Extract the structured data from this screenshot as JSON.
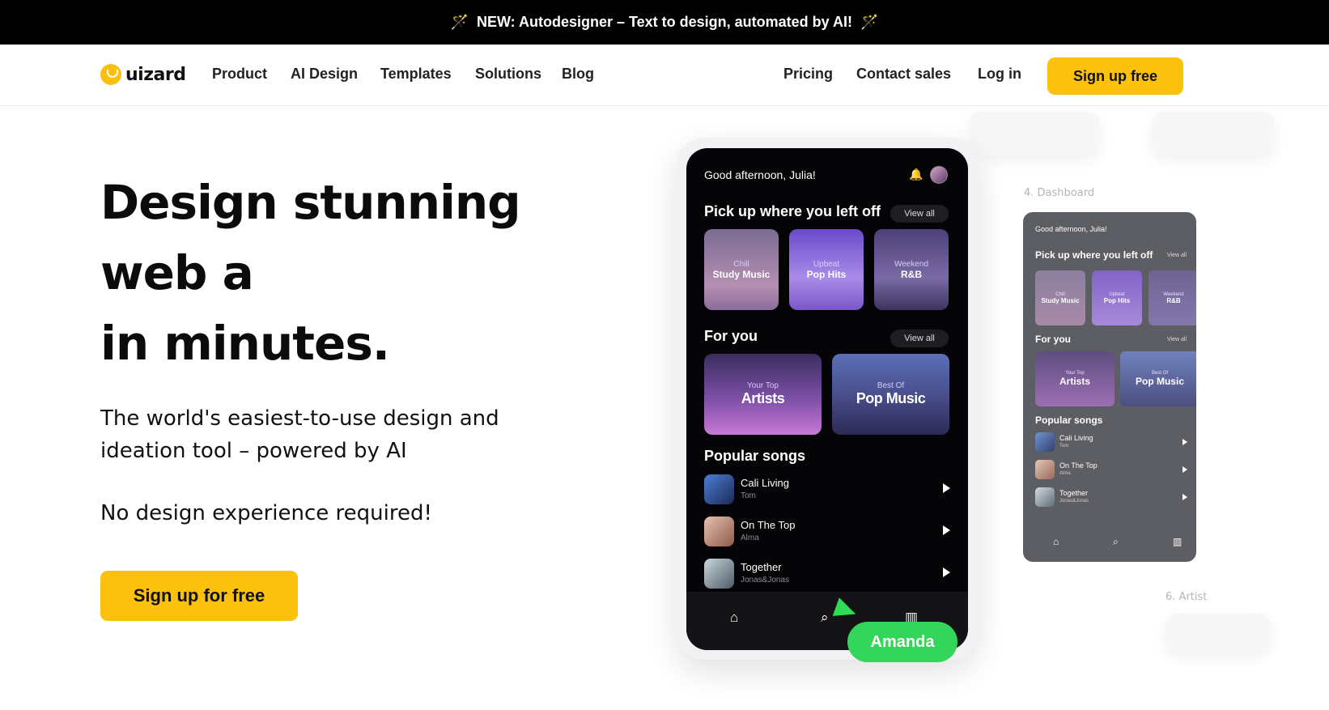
{
  "banner": {
    "text": "NEW: Autodesigner – Text to design, automated by AI!",
    "icon_left": "magic-wand-icon",
    "icon_right": "magic-wand-icon"
  },
  "nav": {
    "logo_text": "uizard",
    "links": [
      "Product",
      "AI Design",
      "Templates",
      "Solutions",
      "Blog"
    ],
    "right_links": [
      "Pricing",
      "Contact sales",
      "Log in"
    ],
    "cta": "Sign up free"
  },
  "hero": {
    "title_lines": [
      "Design stunning",
      "web a",
      "in minutes."
    ],
    "subtitle": "The world's easiest-to-use design and ideation tool – powered by AI",
    "note": "No design experience required!",
    "cta": "Sign up for free"
  },
  "mockup": {
    "greeting": "Good afternoon, Julia!",
    "section_recent": "Pick up where you left off",
    "view_all": "View all",
    "recent_tiles": [
      {
        "small": "Chill",
        "big": "Study Music"
      },
      {
        "small": "Upbeat",
        "big": "Pop Hits"
      },
      {
        "small": "Weekend",
        "big": "R&B"
      }
    ],
    "section_for_you": "For you",
    "for_you_tiles": [
      {
        "small": "Your Top",
        "big": "Artists"
      },
      {
        "small": "Best Of",
        "big": "Pop Music"
      }
    ],
    "section_popular": "Popular songs",
    "songs": [
      {
        "title": "Cali Living",
        "artist": "Tom"
      },
      {
        "title": "On The Top",
        "artist": "Alma"
      },
      {
        "title": "Together",
        "artist": "Jonas&Jonas"
      }
    ],
    "collaborator": "Amanda",
    "screen_labels": [
      "4. Dashboard",
      "6. Artist"
    ]
  },
  "colors": {
    "accent": "#fbc10d",
    "banner_bg": "#000000",
    "cursor": "#33d65a",
    "phone_bg": "#050507"
  }
}
